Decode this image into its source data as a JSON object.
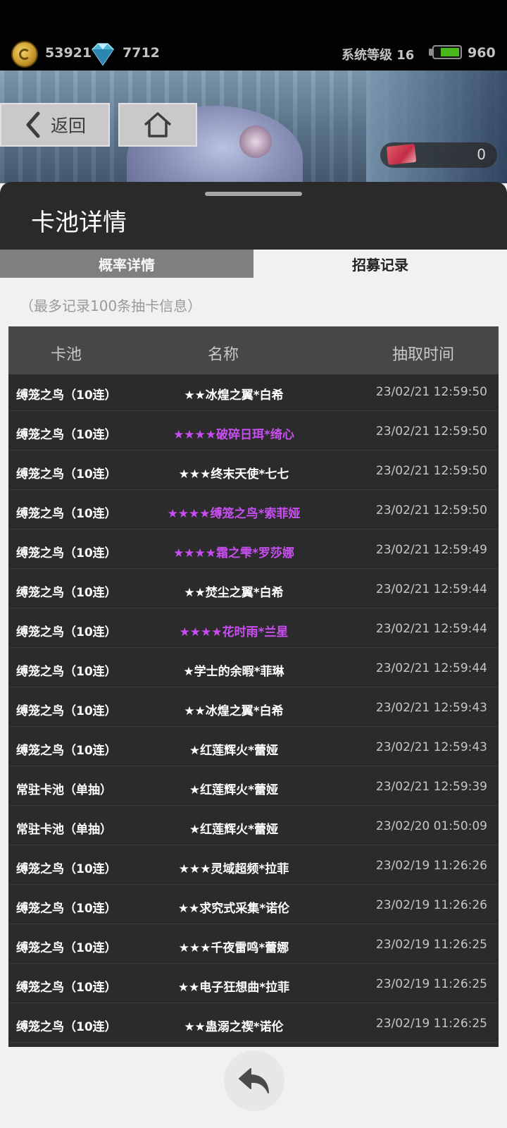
{
  "status_bar": {
    "coins": "53921",
    "gems": "7712",
    "system_level": "系统等级 16",
    "stamina": "960"
  },
  "nav": {
    "back_label": "返回",
    "ticket_count": "0"
  },
  "panel": {
    "title": "卡池详情",
    "tabs": [
      {
        "label": "概率详情",
        "selected": false
      },
      {
        "label": "招募记录",
        "selected": true
      }
    ],
    "note": "（最多记录100条抽卡信息）"
  },
  "table": {
    "headers": [
      "卡池",
      "名称",
      "抽取时间"
    ],
    "rows": [
      {
        "pool": "缚笼之鸟（10连）",
        "name": "★★冰煌之翼*白希",
        "time": "23/02/21 12:59:50",
        "rare": false
      },
      {
        "pool": "缚笼之鸟（10连）",
        "name": "★★★★破碎日珥*绮心",
        "time": "23/02/21 12:59:50",
        "rare": true
      },
      {
        "pool": "缚笼之鸟（10连）",
        "name": "★★★终末天使*七七",
        "time": "23/02/21 12:59:50",
        "rare": false
      },
      {
        "pool": "缚笼之鸟（10连）",
        "name": "★★★★缚笼之鸟*索菲娅",
        "time": "23/02/21 12:59:50",
        "rare": true
      },
      {
        "pool": "缚笼之鸟（10连）",
        "name": "★★★★霜之雫*罗莎娜",
        "time": "23/02/21 12:59:49",
        "rare": true
      },
      {
        "pool": "缚笼之鸟（10连）",
        "name": "★★焚尘之翼*白希",
        "time": "23/02/21 12:59:44",
        "rare": false
      },
      {
        "pool": "缚笼之鸟（10连）",
        "name": "★★★★花时雨*兰星",
        "time": "23/02/21 12:59:44",
        "rare": true
      },
      {
        "pool": "缚笼之鸟（10连）",
        "name": "★学士的余暇*菲琳",
        "time": "23/02/21 12:59:44",
        "rare": false
      },
      {
        "pool": "缚笼之鸟（10连）",
        "name": "★★冰煌之翼*白希",
        "time": "23/02/21 12:59:43",
        "rare": false
      },
      {
        "pool": "缚笼之鸟（10连）",
        "name": "★红莲辉火*蕾娅",
        "time": "23/02/21 12:59:43",
        "rare": false
      },
      {
        "pool": "常驻卡池（单抽）",
        "name": "★红莲辉火*蕾娅",
        "time": "23/02/21 12:59:39",
        "rare": false
      },
      {
        "pool": "常驻卡池（单抽）",
        "name": "★红莲辉火*蕾娅",
        "time": "23/02/20 01:50:09",
        "rare": false
      },
      {
        "pool": "缚笼之鸟（10连）",
        "name": "★★★灵域超频*拉菲",
        "time": "23/02/19 11:26:26",
        "rare": false
      },
      {
        "pool": "缚笼之鸟（10连）",
        "name": "★★求究式采集*诺伦",
        "time": "23/02/19 11:26:26",
        "rare": false
      },
      {
        "pool": "缚笼之鸟（10连）",
        "name": "★★★千夜雷鸣*蕾娜",
        "time": "23/02/19 11:26:25",
        "rare": false
      },
      {
        "pool": "缚笼之鸟（10连）",
        "name": "★★电子狂想曲*拉菲",
        "time": "23/02/19 11:26:25",
        "rare": false
      },
      {
        "pool": "缚笼之鸟（10连）",
        "name": "★★蛊溺之禊*诺伦",
        "time": "23/02/19 11:26:25",
        "rare": false
      }
    ]
  },
  "colors": {
    "rare_name": "#c94ef2",
    "header_bg": "#2a2a2a",
    "row_bg": "#2b2b2b"
  },
  "icons": {
    "coin": "coin-icon",
    "gem": "gem-icon",
    "battery": "battery-icon",
    "back": "chevron-left-icon",
    "home": "home-icon",
    "ticket": "ticket-icon",
    "return": "return-arrow-icon"
  }
}
